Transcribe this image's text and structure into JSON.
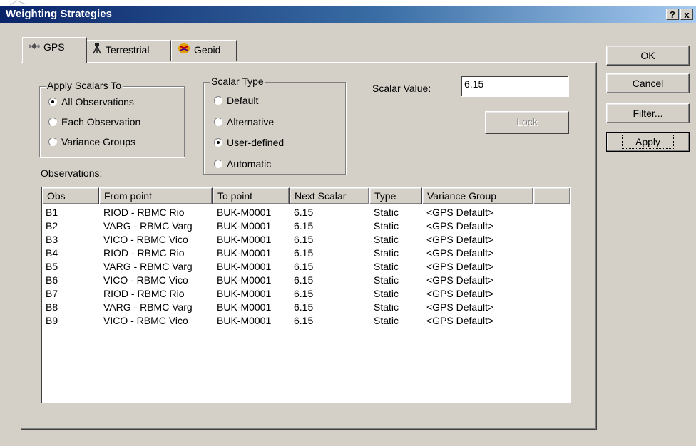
{
  "window": {
    "title": "Weighting Strategies",
    "help_button": "?",
    "close_button": "x"
  },
  "tabs": [
    {
      "label": "GPS",
      "icon": "satellite-icon",
      "active": true
    },
    {
      "label": "Terrestrial",
      "icon": "surveyor-tripod-icon",
      "active": false
    },
    {
      "label": "Geoid",
      "icon": "geoid-icon",
      "active": false
    }
  ],
  "apply_scalars": {
    "title": "Apply Scalars To",
    "options": [
      "All Observations",
      "Each Observation",
      "Variance Groups"
    ],
    "selected": "All Observations"
  },
  "scalar_type": {
    "title": "Scalar Type",
    "options": [
      "Default",
      "Alternative",
      "User-defined",
      "Automatic"
    ],
    "selected": "User-defined"
  },
  "scalar_value": {
    "label": "Scalar Value:",
    "value": "6.15"
  },
  "lock_label": "Lock",
  "buttons": {
    "ok": "OK",
    "cancel": "Cancel",
    "filter": "Filter...",
    "apply": "Apply"
  },
  "observations": {
    "label": "Observations:",
    "columns": [
      "Obs",
      "From point",
      "To point",
      "Next Scalar",
      "Type",
      "Variance Group"
    ],
    "rows": [
      [
        "B1",
        "RIOD - RBMC Rio",
        "BUK-M0001",
        "6.15",
        "Static",
        "<GPS Default>"
      ],
      [
        "B2",
        "VARG - RBMC Varg",
        "BUK-M0001",
        "6.15",
        "Static",
        "<GPS Default>"
      ],
      [
        "B3",
        "VICO - RBMC Vico",
        "BUK-M0001",
        "6.15",
        "Static",
        "<GPS Default>"
      ],
      [
        "B4",
        "RIOD - RBMC Rio",
        "BUK-M0001",
        "6.15",
        "Static",
        "<GPS Default>"
      ],
      [
        "B5",
        "VARG - RBMC Varg",
        "BUK-M0001",
        "6.15",
        "Static",
        "<GPS Default>"
      ],
      [
        "B6",
        "VICO - RBMC Vico",
        "BUK-M0001",
        "6.15",
        "Static",
        "<GPS Default>"
      ],
      [
        "B7",
        "RIOD - RBMC Rio",
        "BUK-M0001",
        "6.15",
        "Static",
        "<GPS Default>"
      ],
      [
        "B8",
        "VARG - RBMC Varg",
        "BUK-M0001",
        "6.15",
        "Static",
        "<GPS Default>"
      ],
      [
        "B9",
        "VICO - RBMC Vico",
        "BUK-M0001",
        "6.15",
        "Static",
        "<GPS Default>"
      ]
    ]
  },
  "colors": {
    "title_gradient_start": "#0a246a",
    "title_gradient_end": "#a6caf0",
    "dialog_face": "#d4d0c8"
  }
}
